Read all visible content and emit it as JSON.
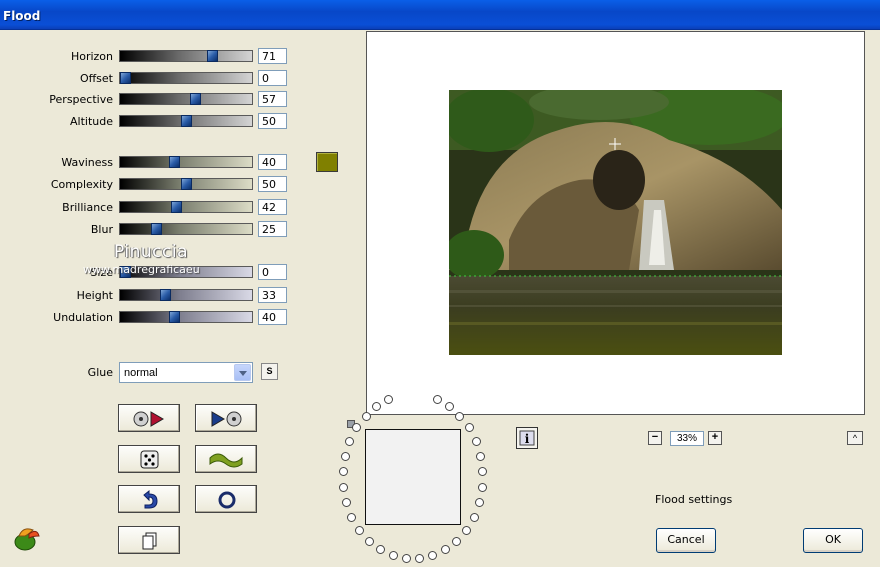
{
  "window": {
    "title": "Flood"
  },
  "sliders": [
    {
      "label": "Horizon",
      "value": "71",
      "pct": 0.71,
      "style": "bw"
    },
    {
      "label": "Offset",
      "value": "0",
      "pct": 0.0,
      "style": "bw"
    },
    {
      "label": "Perspective",
      "value": "57",
      "pct": 0.57,
      "style": "bw"
    },
    {
      "label": "Altitude",
      "value": "50",
      "pct": 0.5,
      "style": "bw"
    },
    {
      "label": "Waviness",
      "value": "40",
      "pct": 0.4,
      "style": "bg"
    },
    {
      "label": "Complexity",
      "value": "50",
      "pct": 0.5,
      "style": "bg"
    },
    {
      "label": "Brilliance",
      "value": "42",
      "pct": 0.42,
      "style": "bg"
    },
    {
      "label": "Blur",
      "value": "25",
      "pct": 0.25,
      "style": "bg"
    },
    {
      "label": "Size",
      "value": "0",
      "pct": 0.0,
      "style": "bl"
    },
    {
      "label": "Height",
      "value": "33",
      "pct": 0.33,
      "style": "bl"
    },
    {
      "label": "Undulation",
      "value": "40",
      "pct": 0.4,
      "style": "bl"
    }
  ],
  "color_swatch": "#808000",
  "watermark": {
    "name": "Pinuccia",
    "url": "www.madregraficaeu"
  },
  "glue": {
    "label": "Glue",
    "value": "normal",
    "small_button": "S"
  },
  "zoom": {
    "minus": "−",
    "value": "33%",
    "plus": "+"
  },
  "up_button": "^",
  "info_button": "i",
  "status_text": "Flood settings",
  "buttons": {
    "cancel": "Cancel",
    "ok": "OK"
  }
}
